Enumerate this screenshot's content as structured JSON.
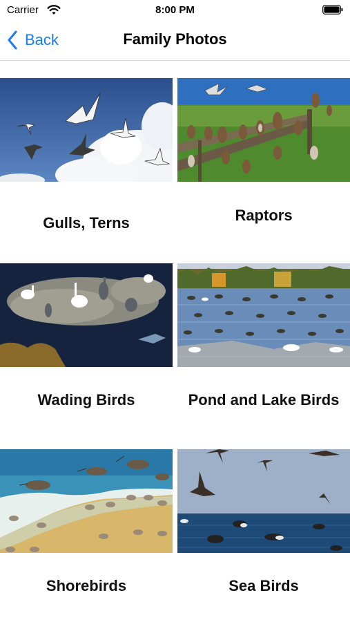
{
  "status_bar": {
    "carrier": "Carrier",
    "time": "8:00 PM",
    "icons": [
      "wifi-icon",
      "battery-icon"
    ]
  },
  "nav": {
    "back_label": "Back",
    "title": "Family Photos",
    "accent_color": "#1a7bf2"
  },
  "families": [
    {
      "label": "Gulls, Terns",
      "image": "gulls-terns-photo"
    },
    {
      "label": "Raptors",
      "image": "raptors-photo"
    },
    {
      "label": "Wading Birds",
      "image": "wading-birds-photo"
    },
    {
      "label": "Pond and Lake Birds",
      "image": "pond-lake-birds-photo"
    },
    {
      "label": "Shorebirds",
      "image": "shorebirds-photo"
    },
    {
      "label": "Sea Birds",
      "image": "sea-birds-photo"
    }
  ]
}
